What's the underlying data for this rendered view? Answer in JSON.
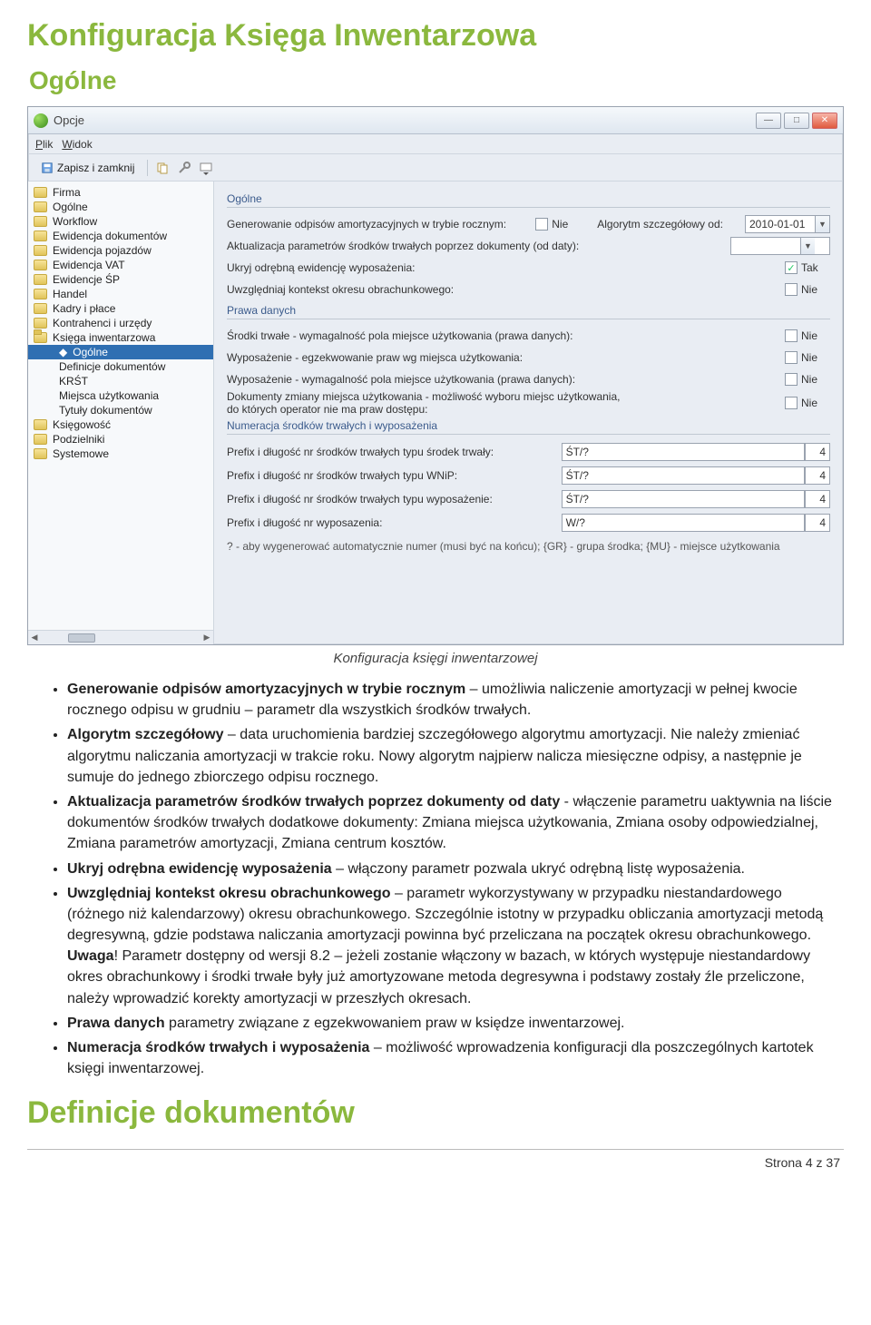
{
  "page": {
    "title": "Konfiguracja Księga Inwentarzowa",
    "section": "Ogólne",
    "caption": "Konfiguracja księgi inwentarzowej",
    "definitions_heading": "Definicje dokumentów",
    "footer": "Strona 4 z 37"
  },
  "window": {
    "title": "Opcje",
    "menu": {
      "file": "Plik",
      "view": "Widok"
    },
    "toolbar": {
      "save_close": "Zapisz i zamknij"
    }
  },
  "tree": {
    "items": [
      {
        "label": "Firma"
      },
      {
        "label": "Ogólne"
      },
      {
        "label": "Workflow"
      },
      {
        "label": "Ewidencja dokumentów"
      },
      {
        "label": "Ewidencja pojazdów"
      },
      {
        "label": "Ewidencja VAT"
      },
      {
        "label": "Ewidencje ŚP"
      },
      {
        "label": "Handel"
      },
      {
        "label": "Kadry i płace"
      },
      {
        "label": "Kontrahenci i urzędy"
      },
      {
        "label": "Księga inwentarzowa"
      }
    ],
    "children": [
      {
        "label": "Ogólne",
        "selected": true
      },
      {
        "label": "Definicje dokumentów"
      },
      {
        "label": "KRŚT"
      },
      {
        "label": "Miejsca użytkowania"
      },
      {
        "label": "Tytuły dokumentów"
      }
    ],
    "items2": [
      {
        "label": "Księgowość"
      },
      {
        "label": "Podzielniki"
      },
      {
        "label": "Systemowe"
      }
    ]
  },
  "form": {
    "sect_ogolne": "Ogólne",
    "row1": {
      "label": "Generowanie odpisów amortyzacyjnych w trybie rocznym:",
      "check": "Nie",
      "extra_label": "Algorytm szczegółowy od:",
      "date": "2010-01-01"
    },
    "row2": {
      "label": "Aktualizacja parametrów środków trwałych poprzez dokumenty (od daty):"
    },
    "row3": {
      "label": "Ukryj odrębną ewidencję wyposażenia:",
      "check": "Tak"
    },
    "row4": {
      "label": "Uwzględniaj kontekst okresu obrachunkowego:",
      "check": "Nie"
    },
    "sect_prawa": "Prawa danych",
    "p1": {
      "label": "Środki trwałe - wymagalność pola miejsce użytkowania (prawa danych):",
      "check": "Nie"
    },
    "p2": {
      "label": "Wyposażenie - egzekwowanie praw wg miejsca użytkowania:",
      "check": "Nie"
    },
    "p3": {
      "label": "Wyposażenie - wymagalność pola miejsce użytkowania (prawa danych):",
      "check": "Nie"
    },
    "p4": {
      "label": "Dokumenty zmiany miejsca użytkowania - możliwość wyboru miejsc użytkowania,",
      "label2": "do których operator nie ma praw dostępu:",
      "check": "Nie"
    },
    "sect_num": "Numeracja środków trwałych i wyposażenia",
    "n1": {
      "label": "Prefix i długość nr środków trwałych typu środek trwały:",
      "prefix": "ŚT/?",
      "len": "4"
    },
    "n2": {
      "label": "Prefix i długość nr środków trwałych typu WNiP:",
      "prefix": "ŚT/?",
      "len": "4"
    },
    "n3": {
      "label": "Prefix i długość nr środków trwałych typu wyposażenie:",
      "prefix": "ŚT/?",
      "len": "4"
    },
    "n4": {
      "label": "Prefix i długość nr wyposazenia:",
      "prefix": "W/?",
      "len": "4"
    },
    "note": "? - aby wygenerować automatycznie numer (musi być na końcu); {GR} - grupa środka; {MU} - miejsce użytkowania"
  },
  "bullets": {
    "b1_bold": "Generowanie odpisów amortyzacyjnych w trybie rocznym",
    "b1_rest": " – umożliwia naliczenie amortyzacji w pełnej kwocie rocznego odpisu w grudniu – parametr dla wszystkich środków trwałych.",
    "b2_bold": "Algorytm szczegółowy",
    "b2_rest": " – data uruchomienia bardziej szczegółowego algorytmu amortyzacji. Nie należy zmieniać algorytmu naliczania amortyzacji w trakcie roku. Nowy algorytm najpierw nalicza miesięczne odpisy, a następnie je sumuje do jednego zbiorczego odpisu rocznego.",
    "b3_bold": "Aktualizacja parametrów środków trwałych poprzez dokumenty od daty",
    "b3_rest": " - włączenie parametru uaktywnia na liście dokumentów środków trwałych dodatkowe dokumenty: Zmiana miejsca użytkowania, Zmiana osoby odpowiedzialnej, Zmiana parametrów amortyzacji, Zmiana centrum kosztów.",
    "b4_bold": "Ukryj odrębna ewidencję wyposażenia",
    "b4_rest": " – włączony parametr pozwala ukryć odrębną listę wyposażenia.",
    "b5_bold": "Uwzględniaj kontekst okresu obrachunkowego",
    "b5_a": " – parametr wykorzystywany w przypadku niestandardowego (różnego niż kalendarzowy) okresu obrachunkowego. Szczególnie istotny w przypadku obliczania amortyzacji metodą degresywną, gdzie podstawa naliczania amortyzacji powinna być przeliczana na początek okresu obrachunkowego. ",
    "b5_uwaga": "Uwaga",
    "b5_b": "! Parametr dostępny od wersji 8.2 – jeżeli zostanie włączony w bazach, w których występuje niestandardowy okres obrachunkowy i środki trwałe były już amortyzowane metoda degresywna i podstawy zostały źle przeliczone, należy wprowadzić korekty amortyzacji w przeszłych okresach.",
    "b6_bold": "Prawa danych",
    "b6_rest": " parametry związane z egzekwowaniem praw w księdze inwentarzowej.",
    "b7_bold": "Numeracja środków trwałych i wyposażenia",
    "b7_rest": " – możliwość wprowadzenia konfiguracji dla poszczególnych kartotek księgi inwentarzowej."
  }
}
